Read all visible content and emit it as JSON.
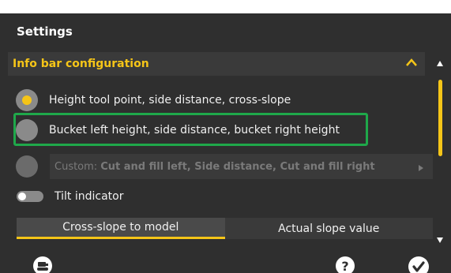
{
  "panel": {
    "title": "Settings",
    "section": {
      "title": "Info bar configuration",
      "expanded": true
    },
    "options": [
      {
        "label": "Height tool point, side distance, cross-slope",
        "selected": true
      },
      {
        "label": "Bucket left height, side distance, bucket right height",
        "selected": false,
        "highlighted": true
      },
      {
        "prefix": "Custom:",
        "value": "Cut and fill left, Side distance, Cut and fill right",
        "selected": false,
        "disabled": true
      }
    ],
    "toggle": {
      "label": "Tilt indicator",
      "on": false
    },
    "segments": [
      {
        "label": "Cross-slope to model",
        "active": true
      },
      {
        "label": "Actual slope value",
        "active": false
      }
    ]
  },
  "icons": {
    "collapse": "chevron-up-icon",
    "scroll_up": "triangle-up-icon",
    "scroll_down": "triangle-down-icon",
    "machine": "machine-icon",
    "help": "question-icon",
    "confirm": "checkmark-icon"
  },
  "colors": {
    "accent": "#f5c518",
    "highlight": "#1fa84a",
    "background": "#2f2f2f"
  }
}
